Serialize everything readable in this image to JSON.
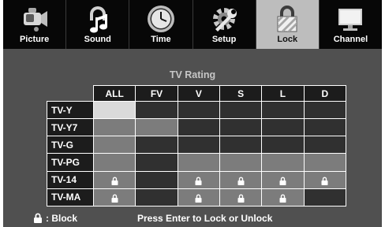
{
  "menu": {
    "tabs": [
      {
        "label": "Picture",
        "icon": "camcorder-icon"
      },
      {
        "label": "Sound",
        "icon": "music-note-icon"
      },
      {
        "label": "Time",
        "icon": "clock-icon"
      },
      {
        "label": "Setup",
        "icon": "wrench-gear-icon"
      },
      {
        "label": "Lock",
        "icon": "padlock-icon",
        "active": true
      },
      {
        "label": "Channel",
        "icon": "monitor-icon"
      }
    ]
  },
  "panel": {
    "title": "TV Rating",
    "columns": [
      "ALL",
      "FV",
      "V",
      "S",
      "L",
      "D"
    ],
    "rows": [
      {
        "label": "TV-Y",
        "cells": [
          "selected",
          "dark",
          "dark",
          "dark",
          "dark",
          "dark"
        ],
        "locks": [
          false,
          false,
          false,
          false,
          false,
          false
        ]
      },
      {
        "label": "TV-Y7",
        "cells": [
          "mid",
          "mid",
          "dark",
          "dark",
          "dark",
          "dark"
        ],
        "locks": [
          false,
          false,
          false,
          false,
          false,
          false
        ]
      },
      {
        "label": "TV-G",
        "cells": [
          "mid",
          "dark",
          "dark",
          "dark",
          "dark",
          "dark"
        ],
        "locks": [
          false,
          false,
          false,
          false,
          false,
          false
        ]
      },
      {
        "label": "TV-PG",
        "cells": [
          "mid",
          "dark",
          "mid",
          "mid",
          "mid",
          "mid"
        ],
        "locks": [
          false,
          false,
          false,
          false,
          false,
          false
        ]
      },
      {
        "label": "TV-14",
        "cells": [
          "mid",
          "dark",
          "mid",
          "mid",
          "mid",
          "mid"
        ],
        "locks": [
          true,
          false,
          true,
          true,
          true,
          true
        ]
      },
      {
        "label": "TV-MA",
        "cells": [
          "mid",
          "dark",
          "mid",
          "mid",
          "mid",
          "dark"
        ],
        "locks": [
          true,
          false,
          true,
          true,
          true,
          false
        ]
      }
    ]
  },
  "footer": {
    "block_label": ": Block",
    "message": "Press Enter to Lock or Unlock"
  },
  "colors": {
    "background": "#505050",
    "menubar": "#070707",
    "active_tab": "#bdbdbd",
    "cell_dark": "#303030",
    "cell_mid": "#7c7c7c",
    "cell_selected": "#dadada",
    "title_text": "#c6c6c6"
  }
}
